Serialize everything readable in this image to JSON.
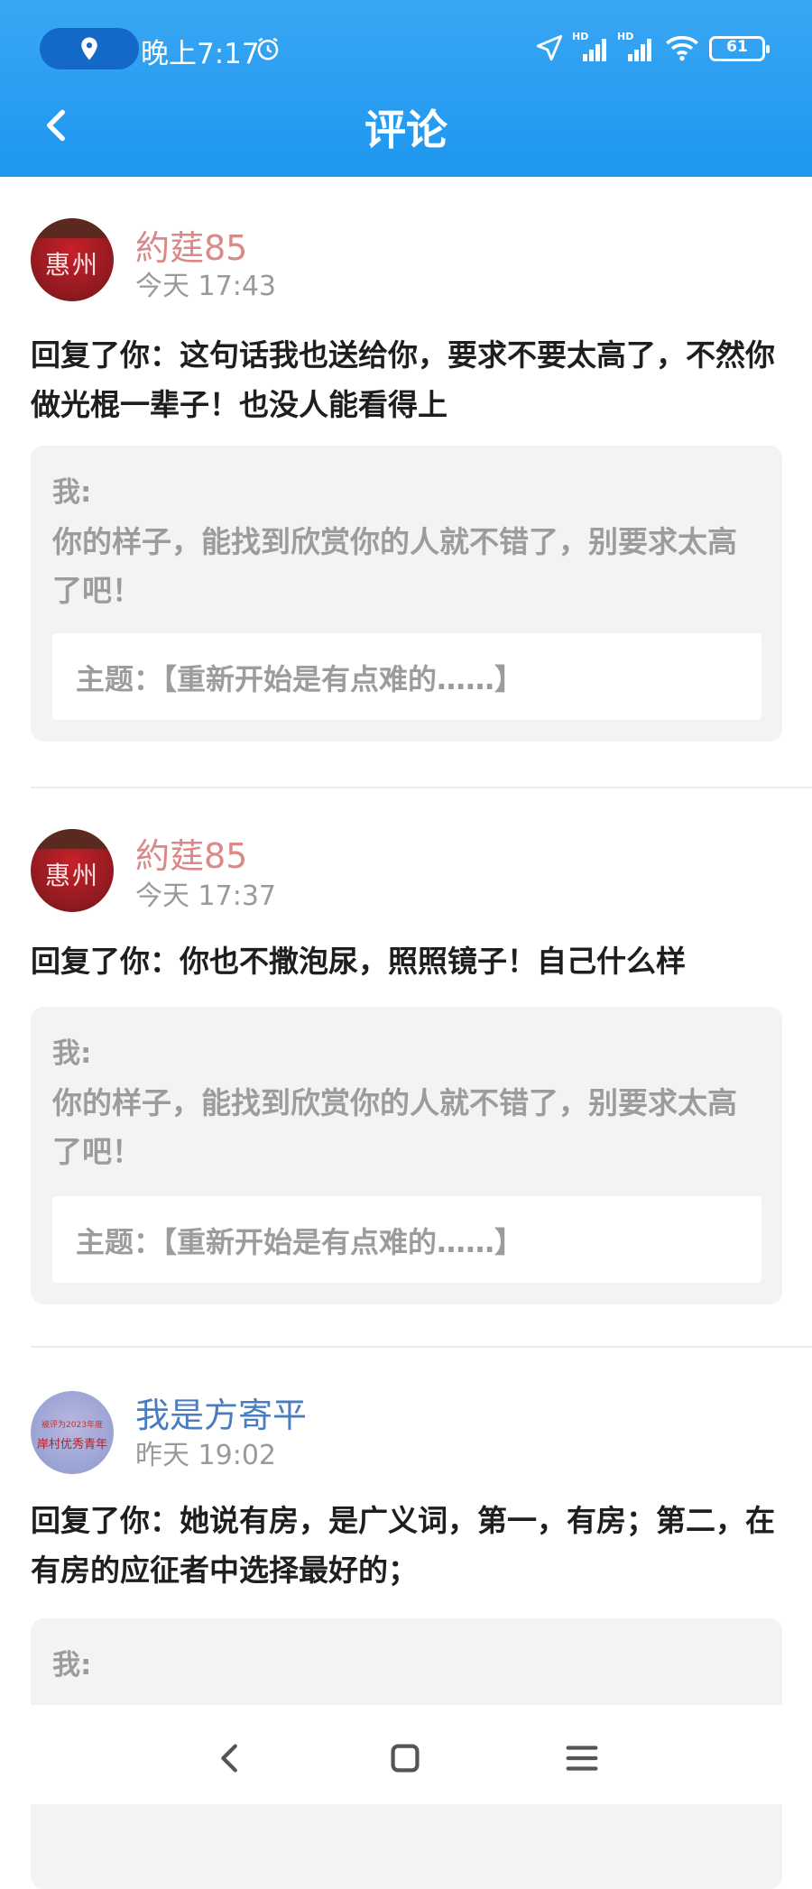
{
  "status_bar": {
    "time": "晚上7:17",
    "battery": "61",
    "network_label_1": "HD",
    "network_label_2": "HD",
    "icons": [
      "location-icon",
      "alarm-icon",
      "navigation-icon",
      "signal-icon",
      "signal-icon",
      "wifi-icon",
      "battery-icon"
    ]
  },
  "nav": {
    "title": "评论",
    "back_icon": "chevron-left-icon"
  },
  "comments": [
    {
      "username": "約莛85",
      "username_color": "#d98a88",
      "avatar_text": "惠州",
      "time": "今天 17:43",
      "reply": "回复了你：这句话我也送给你，要求不要太高了，不然你做光棍一辈子！也没人能看得上",
      "quote_author": "我:",
      "quote_text": "你的样子，能找到欣赏你的人就不错了，别要求太高了吧！",
      "topic": "主题：【重新开始是有点难的……】"
    },
    {
      "username": "約莛85",
      "username_color": "#d98a88",
      "avatar_text": "惠州",
      "time": "今天 17:37",
      "reply": "回复了你：你也不撒泡尿，照照镜子！自己什么样",
      "quote_author": "我:",
      "quote_text": "你的样子，能找到欣赏你的人就不错了，别要求太高了吧！",
      "topic": "主题：【重新开始是有点难的……】"
    },
    {
      "username": "我是方寄平",
      "username_color": "#4a7cc0",
      "avatar_text": "岸村优秀青年",
      "avatar_subtext": "被评为2023年度",
      "time": "昨天 19:02",
      "reply": "回复了你：她说有房，是广义词，第一，有房；第二，在有房的应征者中选择最好的；",
      "quote_author": "我:"
    }
  ],
  "bottom_nav": {
    "icons": [
      "back-icon",
      "home-icon",
      "menu-icon"
    ]
  }
}
